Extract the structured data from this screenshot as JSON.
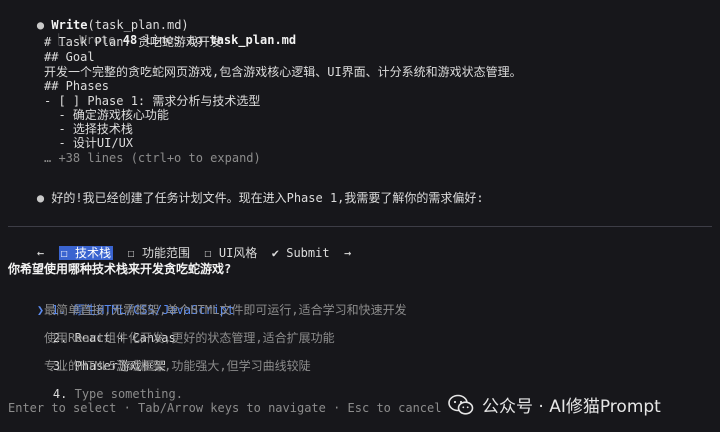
{
  "tool_call": {
    "bullet": "●",
    "name": "Write",
    "arg": "(task_plan.md)",
    "result_prefix": "⎿  Wrote ",
    "lines_count": "48",
    "result_mid": " lines to ",
    "file": "task_plan.md",
    "content_lines": [
      "# Task Plan: 贪吃蛇游戏开发",
      "## Goal",
      "开发一个完整的贪吃蛇网页游戏,包含游戏核心逻辑、UI界面、计分系统和游戏状态管理。",
      "## Phases",
      "- [ ] Phase 1: 需求分析与技术选型",
      "  - 确定游戏核心功能",
      "  - 选择技术栈",
      "  - 设计UI/UX"
    ],
    "expand_hint": "… +38 lines (ctrl+o to expand)"
  },
  "assistant_message": {
    "bullet": "●",
    "text": "好的!我已经创建了任务计划文件。现在进入Phase 1,我需要了解你的需求偏好:"
  },
  "tabs": {
    "left_arrow": "←",
    "items": [
      {
        "label": "☐ 技术栈",
        "active": true
      },
      {
        "label": "☐ 功能范围",
        "active": false
      },
      {
        "label": "☐ UI风格",
        "active": false
      },
      {
        "label": "✔ Submit",
        "active": false
      }
    ],
    "right_arrow": "→"
  },
  "question": "你希望使用哪种技术栈来开发贪吃蛇游戏?",
  "options": [
    {
      "pointer": "❯",
      "number": "1.",
      "title": "原生HTML/CSS/JavaScript",
      "description": "最简单直接,无需框架,单个HTML文件即可运行,适合学习和快速开发",
      "selected": true
    },
    {
      "pointer": "",
      "number": "2.",
      "title": "React + Canvas",
      "description": "使用React组件化开发,更好的状态管理,适合扩展功能",
      "selected": false
    },
    {
      "pointer": "",
      "number": "3.",
      "title": "Phaser游戏框架",
      "description": "专业的HTML5游戏框架,功能强大,但学习曲线较陡",
      "selected": false
    },
    {
      "pointer": "",
      "number": "4.",
      "title": "Type something.",
      "description": "",
      "selected": false
    }
  ],
  "footer_hint": "Enter to select · Tab/Arrow keys to navigate · Esc to cancel",
  "watermark": {
    "icon": "wechat-icon",
    "text": "公众号 · AI修猫Prompt"
  },
  "colors": {
    "background": "#17171b",
    "accent": "#3a64d0",
    "selected_text": "#5b8bf0",
    "dim_text": "#8c8c8c"
  }
}
